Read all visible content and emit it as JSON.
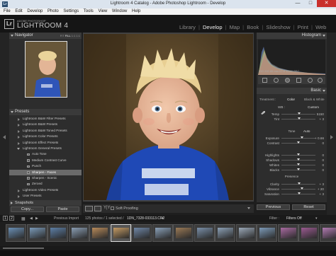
{
  "window": {
    "title": "Lightroom 4 Catalog - Adobe Photoshop Lightroom - Develop",
    "minimize": "—",
    "maximize": "□",
    "close": "✕",
    "app_icon": "Lr"
  },
  "menu": [
    "File",
    "Edit",
    "Develop",
    "Photo",
    "Settings",
    "Tools",
    "View",
    "Window",
    "Help"
  ],
  "identity": {
    "logo": "Lr",
    "brand_small": "ADOBE PHOTOSHOP",
    "brand_big": "LIGHTROOM 4"
  },
  "modules": [
    {
      "label": "Library",
      "active": false
    },
    {
      "label": "Develop",
      "active": true
    },
    {
      "label": "Map",
      "active": false
    },
    {
      "label": "Book",
      "active": false
    },
    {
      "label": "Slideshow",
      "active": false
    },
    {
      "label": "Print",
      "active": false
    },
    {
      "label": "Web",
      "active": false
    }
  ],
  "left_panel": {
    "navigator": {
      "title": "Navigator",
      "zoom_options": [
        "FIT",
        "FILL",
        "1:1",
        "1:1"
      ],
      "active_zoom": "FILL"
    },
    "presets": {
      "title": "Presets",
      "items": [
        {
          "label": "Lightroom B&W Filter Presets",
          "level": 0,
          "open": false,
          "selected": false
        },
        {
          "label": "Lightroom B&W Presets",
          "level": 0,
          "open": false,
          "selected": false
        },
        {
          "label": "Lightroom B&W Toned Presets",
          "level": 0,
          "open": false,
          "selected": false
        },
        {
          "label": "Lightroom Color Presets",
          "level": 0,
          "open": false,
          "selected": false
        },
        {
          "label": "Lightroom Effect Presets",
          "level": 0,
          "open": false,
          "selected": false
        },
        {
          "label": "Lightroom General Presets",
          "level": 0,
          "open": true,
          "selected": false
        },
        {
          "label": "Auto Tone",
          "level": 1,
          "open": false,
          "selected": false
        },
        {
          "label": "Medium Contrast Curve",
          "level": 1,
          "open": false,
          "selected": false
        },
        {
          "label": "Punch",
          "level": 1,
          "open": false,
          "selected": false
        },
        {
          "label": "Sharpen - Faces",
          "level": 1,
          "open": false,
          "selected": true
        },
        {
          "label": "Sharpen - Scenic",
          "level": 1,
          "open": false,
          "selected": false
        },
        {
          "label": "Zeroed",
          "level": 1,
          "open": false,
          "selected": false
        },
        {
          "label": "Lightroom Video Presets",
          "level": 0,
          "open": false,
          "selected": false
        },
        {
          "label": "User Presets",
          "level": 0,
          "open": false,
          "selected": false
        }
      ]
    },
    "snapshots": {
      "title": "Snapshots"
    },
    "copy_button": "Copy...",
    "paste_button": "Paste"
  },
  "toolbar": {
    "yy_label": "Y|Y",
    "soft_proofing": "Soft Proofing"
  },
  "right_panel": {
    "histogram": {
      "title": "Histogram",
      "meta": "ISO 200   85 mm   f/2.8   1/250 SEC"
    },
    "basic": {
      "title": "Basic",
      "treatment_label": "Treatment :",
      "color": "Color",
      "bw": "Black & White",
      "wb_label": "WB :",
      "wb_value": "Custom",
      "tone_label": "Tone",
      "auto_label": "Auto",
      "presence_label": "Presence",
      "sliders": [
        {
          "label": "Temp",
          "value": "5150",
          "pos": 0.53
        },
        {
          "label": "Tint",
          "value": "+ 3",
          "pos": 0.52
        },
        {
          "label": "Exposure",
          "value": "+ 0.66",
          "pos": 0.6
        },
        {
          "label": "Contrast",
          "value": "0",
          "pos": 0.5
        },
        {
          "label": "Highlights",
          "value": "0",
          "pos": 0.5
        },
        {
          "label": "Shadows",
          "value": "0",
          "pos": 0.5
        },
        {
          "label": "Whites",
          "value": "0",
          "pos": 0.5
        },
        {
          "label": "Blacks",
          "value": "0",
          "pos": 0.5
        },
        {
          "label": "Clarity",
          "value": "+ 3",
          "pos": 0.52
        },
        {
          "label": "Vibrance",
          "value": "+ 20",
          "pos": 0.6
        },
        {
          "label": "Saturation",
          "value": "+ 3",
          "pos": 0.52
        }
      ]
    },
    "previous_button": "Previous",
    "reset_button": "Reset"
  },
  "filmstrip": {
    "screen_1": "1",
    "screen_2": "2",
    "previous_import": "Previous Import",
    "count": "125 photos / 1 selected /",
    "filename": "1DN_7328-033113.CR2",
    "filter_label": "Filter :",
    "filter_value": "Filters Off"
  }
}
